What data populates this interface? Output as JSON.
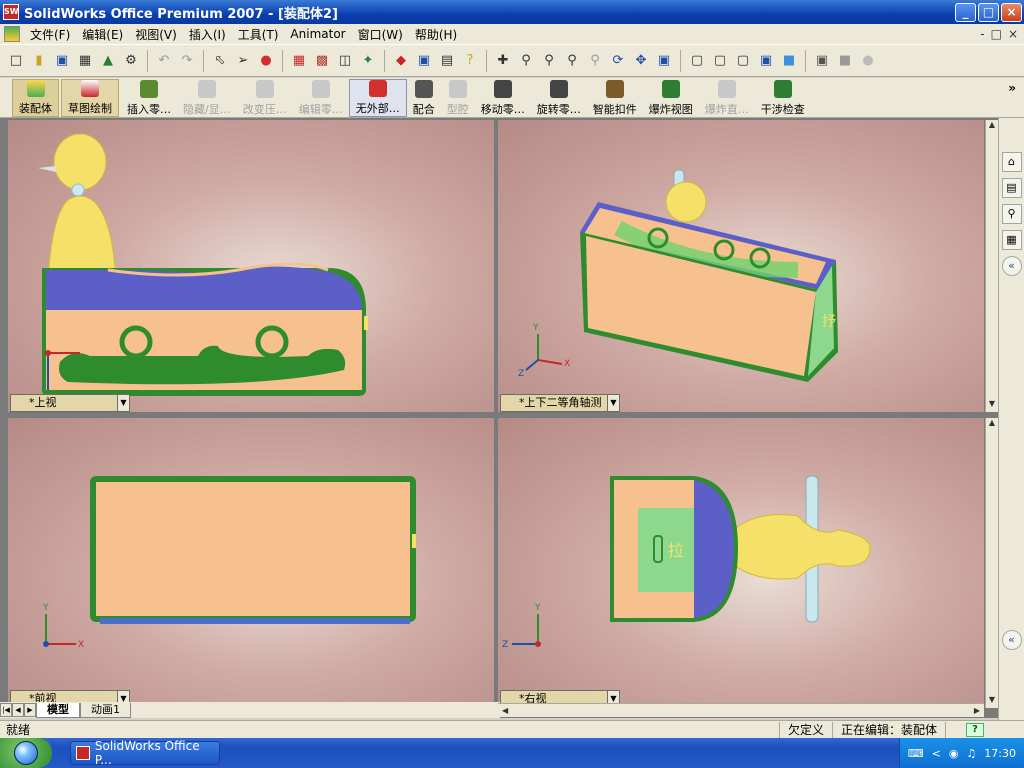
{
  "window": {
    "icon_text": "SW",
    "title": "SolidWorks Office Premium 2007 - [装配体2]",
    "min": "_",
    "max": "□",
    "close": "×"
  },
  "menu": {
    "items": [
      "文件(F)",
      "编辑(E)",
      "视图(V)",
      "插入(I)",
      "工具(T)",
      "Animator",
      "窗口(W)",
      "帮助(H)"
    ],
    "right": [
      "-",
      "□",
      "×"
    ]
  },
  "command_manager": {
    "tabs": [
      {
        "label": "装配体"
      },
      {
        "label": "草图绘制"
      }
    ],
    "commands": [
      {
        "label": "插入零…",
        "enabled": true,
        "color": "#5c8a2e"
      },
      {
        "label": "隐藏/显…",
        "enabled": false,
        "color": "#c8c8c8"
      },
      {
        "label": "改变压…",
        "enabled": false,
        "color": "#c8c8c8"
      },
      {
        "label": "编辑零…",
        "enabled": false,
        "color": "#c8c8c8"
      },
      {
        "label": "无外部…",
        "enabled": true,
        "color": "#d32f2f",
        "pressed": true
      },
      {
        "label": "配合",
        "enabled": true,
        "color": "#555555"
      },
      {
        "label": "型腔",
        "enabled": false,
        "color": "#c8c8c8"
      },
      {
        "label": "移动零…",
        "enabled": true,
        "color": "#444444"
      },
      {
        "label": "旋转零…",
        "enabled": true,
        "color": "#444444"
      },
      {
        "label": "智能扣件",
        "enabled": true,
        "color": "#7b5b2a"
      },
      {
        "label": "爆炸视图",
        "enabled": true,
        "color": "#2e7d32"
      },
      {
        "label": "爆炸直…",
        "enabled": false,
        "color": "#c8c8c8"
      },
      {
        "label": "干涉检查",
        "enabled": true,
        "color": "#2e7d32"
      }
    ]
  },
  "viewports": {
    "top": {
      "label": "*上视"
    },
    "iso": {
      "label": "*上下二等角轴测"
    },
    "front": {
      "label": "*前视"
    },
    "right": {
      "label": "*右视"
    }
  },
  "part_text": {
    "tab_char": "拉",
    "side_char": "抒"
  },
  "triad": {
    "x": "X",
    "y": "Y",
    "z": "Z"
  },
  "bottom_tabs": {
    "model": "模型",
    "animation": "动画1"
  },
  "status": {
    "left": "就绪",
    "underdefined": "欠定义",
    "editing": "正在编辑：装配体",
    "help": "?"
  },
  "taskbar": {
    "app_button": "SolidWorks Office P...",
    "clock": "17:30"
  },
  "colors": {
    "body": "#f7c18f",
    "top_face": "#5b5fc7",
    "green_edge": "#2e8b2e",
    "figure": "#f5e06a",
    "pin": "#c8e8ee"
  }
}
